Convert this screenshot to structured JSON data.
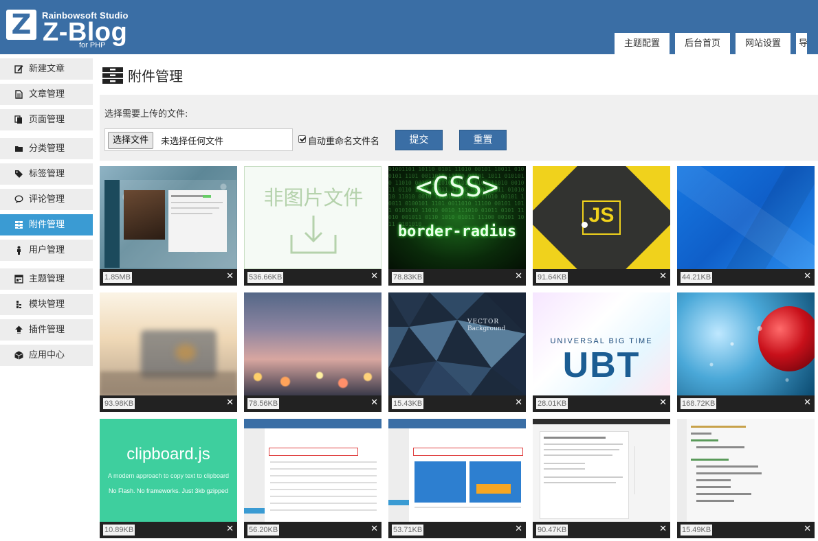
{
  "brand": {
    "studio": "Rainbowsoft Studio",
    "title": "Z-Blog",
    "sub": "for PHP",
    "mark": "Z"
  },
  "top_tabs": [
    "主题配置",
    "后台首页",
    "网站设置",
    "导"
  ],
  "sidebar": {
    "items": [
      {
        "label": "新建文章",
        "icon": "edit-icon",
        "active": false
      },
      {
        "label": "文章管理",
        "icon": "article-icon",
        "active": false
      },
      {
        "label": "页面管理",
        "icon": "page-icon",
        "active": false
      },
      {
        "label": "分类管理",
        "icon": "folder-icon",
        "active": false
      },
      {
        "label": "标签管理",
        "icon": "tag-icon",
        "active": false
      },
      {
        "label": "评论管理",
        "icon": "comment-icon",
        "active": false
      },
      {
        "label": "附件管理",
        "icon": "attachment-icon",
        "active": true
      },
      {
        "label": "用户管理",
        "icon": "user-icon",
        "active": false
      },
      {
        "label": "主题管理",
        "icon": "theme-icon",
        "active": false
      },
      {
        "label": "模块管理",
        "icon": "module-icon",
        "active": false
      },
      {
        "label": "插件管理",
        "icon": "plugin-icon",
        "active": false
      },
      {
        "label": "应用中心",
        "icon": "app-center-icon",
        "active": false
      }
    ]
  },
  "page": {
    "title": "附件管理",
    "icon": "attachment-header-icon"
  },
  "upload": {
    "label": "选择需要上传的文件:",
    "choose_file": "选择文件",
    "no_file": "未选择任何文件",
    "auto_rename_label": "自动重命名文件名",
    "auto_rename_checked": true,
    "submit": "提交",
    "reset": "重置"
  },
  "attachments": [
    {
      "size": "1.85MB",
      "kind": "screenshot"
    },
    {
      "size": "536.66KB",
      "kind": "non-image",
      "label": "非图片文件"
    },
    {
      "size": "78.83KB",
      "kind": "css",
      "line1": "<CSS>",
      "line2": "border-radius"
    },
    {
      "size": "91.64KB",
      "kind": "js",
      "label": "JS"
    },
    {
      "size": "44.21KB",
      "kind": "blue"
    },
    {
      "size": "93.98KB",
      "kind": "blur-laptop"
    },
    {
      "size": "78.56KB",
      "kind": "bokeh"
    },
    {
      "size": "15.43KB",
      "kind": "vector",
      "label1": "VECTOR",
      "label2": "Background"
    },
    {
      "size": "28.01KB",
      "kind": "ubt",
      "label1": "UNIVERSAL BIG TIME",
      "label2": "UBT"
    },
    {
      "size": "168.72KB",
      "kind": "cherry"
    },
    {
      "size": "10.89KB",
      "kind": "clipboard",
      "title": "clipboard.js",
      "line1": "A modern approach to copy text to clipboard",
      "line2": "No Flash. No frameworks. Just 3kb gzipped"
    },
    {
      "size": "56.20KB",
      "kind": "zblog-shot"
    },
    {
      "size": "53.71KB",
      "kind": "zblog-shot2"
    },
    {
      "size": "90.47KB",
      "kind": "doc-shot"
    },
    {
      "size": "15.49KB",
      "kind": "code-shot"
    }
  ],
  "colors": {
    "header": "#3a6ea5",
    "sidebar_bg": "#ededed",
    "sidebar_active": "#3a9bd3",
    "panel_bg": "#f0f0f0",
    "button": "#3a6ea5"
  }
}
